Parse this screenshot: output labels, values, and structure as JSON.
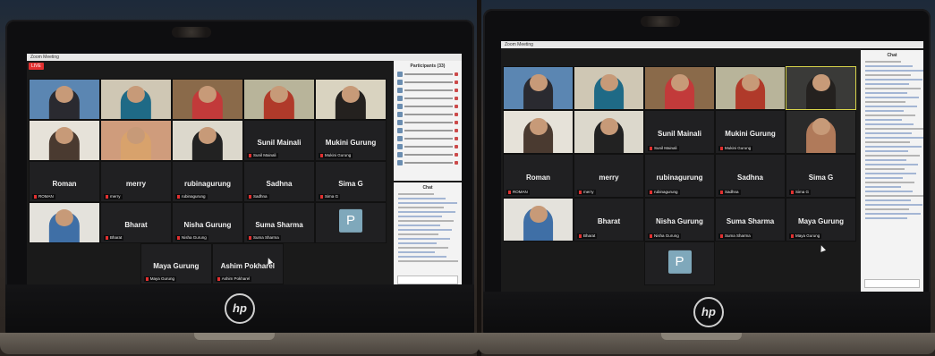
{
  "left_meeting": {
    "window_title": "Zoom Meeting",
    "live_label": "LIVE",
    "meeting_chip": "",
    "participants_title": "Participants (33)",
    "chat_title": "Chat",
    "tiles": [
      {
        "label": "",
        "tag": "",
        "kind": "video",
        "bg": "#5b86b2",
        "shirt": "#2a2a30"
      },
      {
        "label": "",
        "tag": "",
        "kind": "video",
        "bg": "#cfc7b4",
        "shirt": "#1f6a86"
      },
      {
        "label": "",
        "tag": "",
        "kind": "video",
        "bg": "#8a6a4a",
        "shirt": "#c23a3a"
      },
      {
        "label": "",
        "tag": "",
        "kind": "video",
        "bg": "#b8b49a",
        "shirt": "#b03a2a"
      },
      {
        "label": "",
        "tag": "",
        "kind": "video",
        "bg": "#d9d3c0",
        "shirt": "#24211f"
      },
      {
        "label": "",
        "tag": "",
        "kind": "video",
        "bg": "#e6e2d9",
        "shirt": "#4a3a30"
      },
      {
        "label": "",
        "tag": "",
        "kind": "video",
        "bg": "#cf9c7c",
        "shirt": "#d8a26c"
      },
      {
        "label": "",
        "tag": "",
        "kind": "video",
        "bg": "#dcd8cc",
        "shirt": "#222"
      },
      {
        "label": "Sunil Mainali",
        "tag": "Sunil Mainali",
        "kind": "name"
      },
      {
        "label": "Mukini Gurung",
        "tag": "Mukini Gurung",
        "kind": "name"
      },
      {
        "label": "Roman",
        "tag": "ROMAN",
        "kind": "name"
      },
      {
        "label": "merry",
        "tag": "merry",
        "kind": "name"
      },
      {
        "label": "rubinagurung",
        "tag": "rubinagurung",
        "kind": "name"
      },
      {
        "label": "Sadhna",
        "tag": "Sadhna",
        "kind": "name"
      },
      {
        "label": "Sima G",
        "tag": "Sima G",
        "kind": "name"
      },
      {
        "label": "",
        "tag": "",
        "kind": "video",
        "bg": "#e4e2dc",
        "shirt": "#3f6fa6"
      },
      {
        "label": "Bharat",
        "tag": "Bharat",
        "kind": "name"
      },
      {
        "label": "Nisha Gurung",
        "tag": "Nisha Gurung",
        "kind": "name"
      },
      {
        "label": "Suma Sharma",
        "tag": "Suma Sharma",
        "kind": "name"
      },
      {
        "label": "P",
        "tag": "",
        "kind": "avatar"
      },
      {
        "label": "Maya Gurung",
        "tag": "Maya Gurung",
        "kind": "name"
      },
      {
        "label": "Ashim Pokharel",
        "tag": "Ashim Pokharel",
        "kind": "name"
      }
    ]
  },
  "right_meeting": {
    "window_title": "Zoom Meeting",
    "chat_title": "Chat",
    "tiles": [
      {
        "label": "",
        "tag": "",
        "kind": "video",
        "bg": "#5b86b2",
        "shirt": "#2a2a30"
      },
      {
        "label": "",
        "tag": "",
        "kind": "video",
        "bg": "#cfc7b4",
        "shirt": "#1f6a86"
      },
      {
        "label": "",
        "tag": "",
        "kind": "video",
        "bg": "#8a6a4a",
        "shirt": "#c23a3a"
      },
      {
        "label": "",
        "tag": "",
        "kind": "video",
        "bg": "#b8b49a",
        "shirt": "#b03a2a"
      },
      {
        "label": "",
        "tag": "",
        "kind": "video",
        "bg": "#3a3a38",
        "shirt": "#24211f",
        "active": true
      },
      {
        "label": "",
        "tag": "",
        "kind": "video",
        "bg": "#e6e2d9",
        "shirt": "#4a3a30"
      },
      {
        "label": "",
        "tag": "",
        "kind": "video",
        "bg": "#dcd8cc",
        "shirt": "#222"
      },
      {
        "label": "Sunil Mainali",
        "tag": "Sunil Mainali",
        "kind": "name"
      },
      {
        "label": "Mukini Gurung",
        "tag": "Mukini Gurung",
        "kind": "name"
      },
      {
        "label": "",
        "tag": "",
        "kind": "video",
        "bg": "#2a2a2a",
        "shirt": "#b07a5a"
      },
      {
        "label": "Roman",
        "tag": "ROMAN",
        "kind": "name"
      },
      {
        "label": "merry",
        "tag": "merry",
        "kind": "name"
      },
      {
        "label": "rubinagurung",
        "tag": "rubinagurung",
        "kind": "name"
      },
      {
        "label": "Sadhna",
        "tag": "Sadhna",
        "kind": "name"
      },
      {
        "label": "Sima G",
        "tag": "Sima G",
        "kind": "name"
      },
      {
        "label": "",
        "tag": "",
        "kind": "video",
        "bg": "#e4e2dc",
        "shirt": "#3f6fa6"
      },
      {
        "label": "Bharat",
        "tag": "Bharat",
        "kind": "name"
      },
      {
        "label": "Nisha Gurung",
        "tag": "Nisha Gurung",
        "kind": "name"
      },
      {
        "label": "Suma Sharma",
        "tag": "Suma Sharma",
        "kind": "name"
      },
      {
        "label": "Maya Gurung",
        "tag": "Maya Gurung",
        "kind": "name"
      },
      {
        "label": "P",
        "tag": "",
        "kind": "avatar"
      }
    ]
  },
  "brand": {
    "logo_text": "hp"
  },
  "colors": {
    "active_speaker": "#d7d34a",
    "live_red": "#e23030",
    "tile_bg": "#202022"
  }
}
